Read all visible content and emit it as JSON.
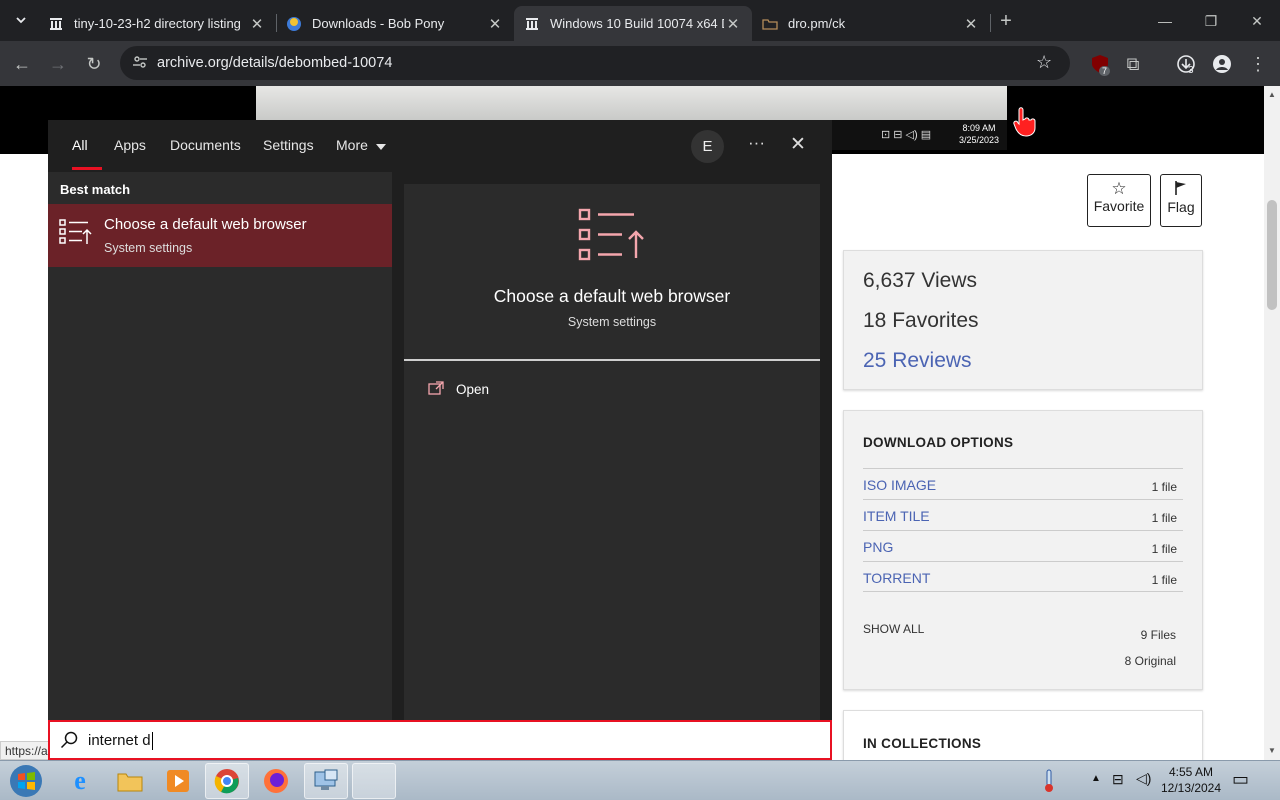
{
  "browser": {
    "tabs": [
      {
        "title": "tiny-10-23-h2 directory listing",
        "icon": "archive-icon",
        "active": false
      },
      {
        "title": "Downloads - Bob Pony",
        "icon": "site-icon",
        "active": false
      },
      {
        "title": "Windows 10 Build 10074 x64 D",
        "icon": "archive-icon",
        "active": true
      },
      {
        "title": "dro.pm/ck",
        "icon": "folder-icon",
        "active": false
      }
    ],
    "url": "archive.org/details/debombed-10074",
    "extension_badge": "7",
    "download_badge": "3",
    "status_url": "https://a"
  },
  "screenshot_inset": {
    "time": "8:09 AM",
    "date": "3/25/2023"
  },
  "item": {
    "favorite_label": "Favorite",
    "flag_label": "Flag",
    "views": "6,637 Views",
    "favorites": "18 Favorites",
    "reviews": "25 Reviews",
    "download_heading": "DOWNLOAD OPTIONS",
    "download_rows": [
      {
        "name": "ISO IMAGE",
        "count": "1 file"
      },
      {
        "name": "ITEM TILE",
        "count": "1 file"
      },
      {
        "name": "PNG",
        "count": "1 file"
      },
      {
        "name": "TORRENT",
        "count": "1 file"
      }
    ],
    "show_all": "SHOW ALL",
    "files_total": "9 Files",
    "files_original": "8 Original",
    "collections_heading": "IN COLLECTIONS"
  },
  "search": {
    "tabs": [
      "All",
      "Apps",
      "Documents",
      "Settings",
      "More"
    ],
    "avatar_letter": "E",
    "best_match_label": "Best match",
    "result_title": "Choose a default web browser",
    "result_subtitle": "System settings",
    "preview_title": "Choose a default web browser",
    "preview_subtitle": "System settings",
    "open_label": "Open",
    "query": "internet d",
    "accent": "#e81123"
  },
  "taskbar": {
    "time": "4:55 AM",
    "date": "12/13/2024",
    "apps": [
      "start-orb",
      "internet-explorer",
      "file-explorer",
      "media-player",
      "chrome",
      "firefox",
      "remote-desktop",
      "blank-window"
    ]
  }
}
